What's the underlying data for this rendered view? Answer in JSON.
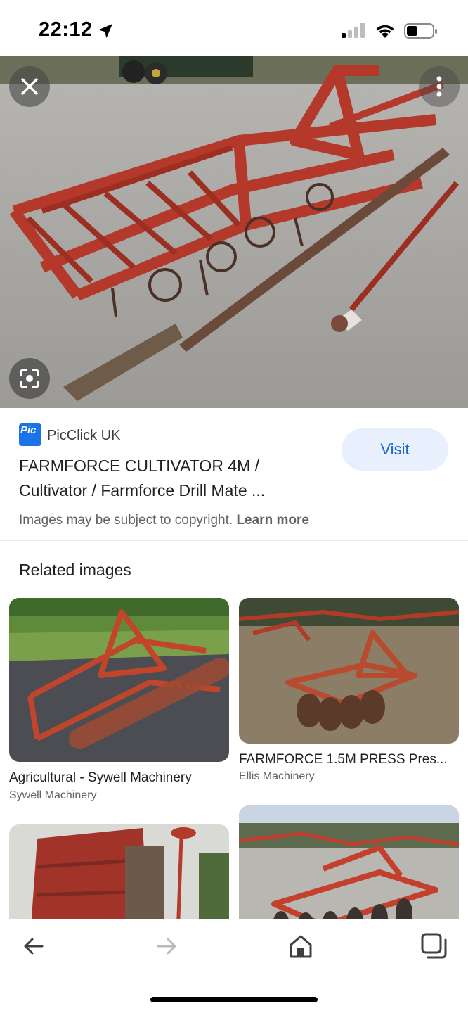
{
  "status_bar": {
    "time": "22:12"
  },
  "result": {
    "source_name": "PicClick UK",
    "source_logo_text": "Pic",
    "title_line1": "FARMFORCE CULTIVATOR 4M /",
    "title_line2": "Cultivator / Farmforce Drill Mate ...",
    "visit_label": "Visit",
    "copyright_text": "Images may be subject to copyright.",
    "learn_more_label": "Learn more"
  },
  "related": {
    "heading": "Related images",
    "items": [
      {
        "title": "Agricultural - Sywell Machinery",
        "source": "Sywell Machinery"
      },
      {
        "title": "FARMFORCE 1.5M PRESS Pres...",
        "source": "Ellis Machinery"
      },
      {
        "title": "",
        "source": ""
      },
      {
        "title": "",
        "source": ""
      }
    ]
  },
  "icons": {
    "close": "close-icon",
    "more": "more-vert-icon",
    "lens": "lens-icon",
    "back": "back-arrow-icon",
    "forward": "forward-arrow-icon",
    "home": "home-icon",
    "tabs": "tabs-icon"
  },
  "colors": {
    "accent": "#1967d2",
    "visit_bg": "#e8f0fe",
    "machinery_red": "#b5392b"
  }
}
